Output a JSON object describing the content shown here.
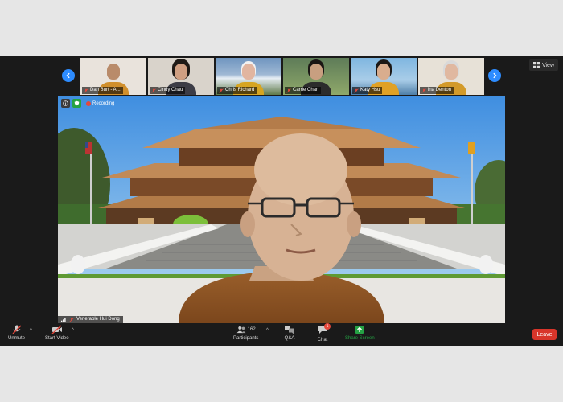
{
  "view_label": "View",
  "participants_strip": [
    {
      "name": "Dan Burt - A...",
      "bg": "#e9e3dc"
    },
    {
      "name": "Cindy Chau",
      "bg": "#d9d3cb"
    },
    {
      "name": "Chris Richard",
      "bg": "#6f95bf"
    },
    {
      "name": "Carrie Chan",
      "bg": "#5e7c58"
    },
    {
      "name": "Katy Hsu",
      "bg": "#7fb6e0"
    },
    {
      "name": "ina Denton",
      "bg": "#e7e1d7"
    }
  ],
  "recording": {
    "label": "Recording"
  },
  "active_speaker": {
    "name": "Venerable Hui Dong"
  },
  "toolbar": {
    "unmute": "Unmute",
    "start_video": "Start Video",
    "participants": "Participants",
    "participants_count": "162",
    "qa": "Q&A",
    "chat": "Chat",
    "chat_badge": "1",
    "share_screen": "Share Screen",
    "leave": "Leave"
  },
  "colors": {
    "accent_blue": "#2d8cff",
    "leave_red": "#d8352a",
    "share_green": "#25a244",
    "toolbar_bg": "#1a1a1a"
  }
}
